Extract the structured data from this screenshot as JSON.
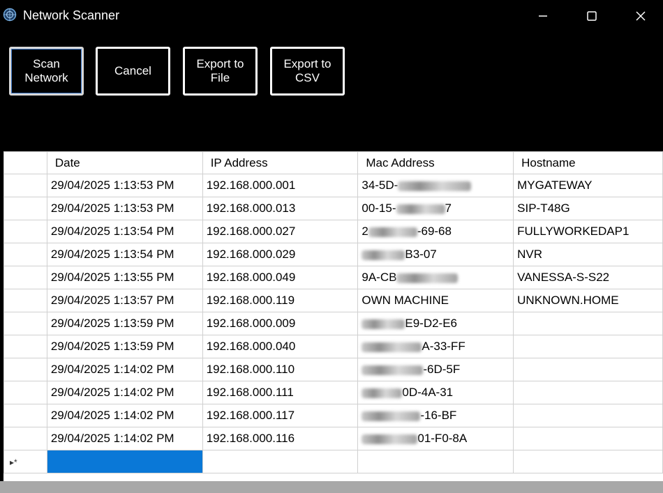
{
  "window": {
    "title": "Network Scanner"
  },
  "toolbar": {
    "scan_label": "Scan\nNetwork",
    "cancel_label": "Cancel",
    "export_file_label": "Export to\nFile",
    "export_csv_label": "Export to\nCSV"
  },
  "grid": {
    "columns": [
      "Date",
      "IP Address",
      "Mac Address",
      "Hostname"
    ],
    "rows": [
      {
        "date": "29/04/2025 1:13:53 PM",
        "ip": "192.168.000.001",
        "mac": "34-5D-",
        "mac_suffix": "",
        "hostname": "MYGATEWAY"
      },
      {
        "date": "29/04/2025 1:13:53 PM",
        "ip": "192.168.000.013",
        "mac": "00-15-",
        "mac_suffix": "7",
        "hostname": "SIP-T48G"
      },
      {
        "date": "29/04/2025 1:13:54 PM",
        "ip": "192.168.000.027",
        "mac": "2",
        "mac_suffix": "-69-68",
        "hostname": "FULLYWORKEDAP1"
      },
      {
        "date": "29/04/2025 1:13:54 PM",
        "ip": "192.168.000.029",
        "mac": "",
        "mac_suffix": "B3-07",
        "hostname": "NVR"
      },
      {
        "date": "29/04/2025 1:13:55 PM",
        "ip": "192.168.000.049",
        "mac": "9A-CB",
        "mac_suffix": "",
        "hostname": "VANESSA-S-S22"
      },
      {
        "date": "29/04/2025 1:13:57 PM",
        "ip": "192.168.000.119",
        "mac": "OWN MACHINE",
        "mac_suffix": "",
        "hostname": "UNKNOWN.HOME"
      },
      {
        "date": "29/04/2025 1:13:59 PM",
        "ip": "192.168.000.009",
        "mac": "",
        "mac_suffix": "E9-D2-E6",
        "hostname": ""
      },
      {
        "date": "29/04/2025 1:13:59 PM",
        "ip": "192.168.000.040",
        "mac": "",
        "mac_suffix": "A-33-FF",
        "hostname": ""
      },
      {
        "date": "29/04/2025 1:14:02 PM",
        "ip": "192.168.000.110",
        "mac": "",
        "mac_suffix": "-6D-5F",
        "hostname": ""
      },
      {
        "date": "29/04/2025 1:14:02 PM",
        "ip": "192.168.000.111",
        "mac": "",
        "mac_suffix": "0D-4A-31",
        "hostname": ""
      },
      {
        "date": "29/04/2025 1:14:02 PM",
        "ip": "192.168.000.117",
        "mac": "",
        "mac_suffix": "-16-BF",
        "hostname": ""
      },
      {
        "date": "29/04/2025 1:14:02 PM",
        "ip": "192.168.000.116",
        "mac": "",
        "mac_suffix": "01-F0-8A",
        "hostname": ""
      }
    ]
  },
  "colors": {
    "background": "#000000",
    "selection": "#0a78d7"
  },
  "icons": {
    "app": "network-scanner-icon",
    "minimize": "minimize-icon",
    "maximize": "maximize-icon",
    "close": "close-icon",
    "new_row": "new-row-indicator-icon"
  }
}
